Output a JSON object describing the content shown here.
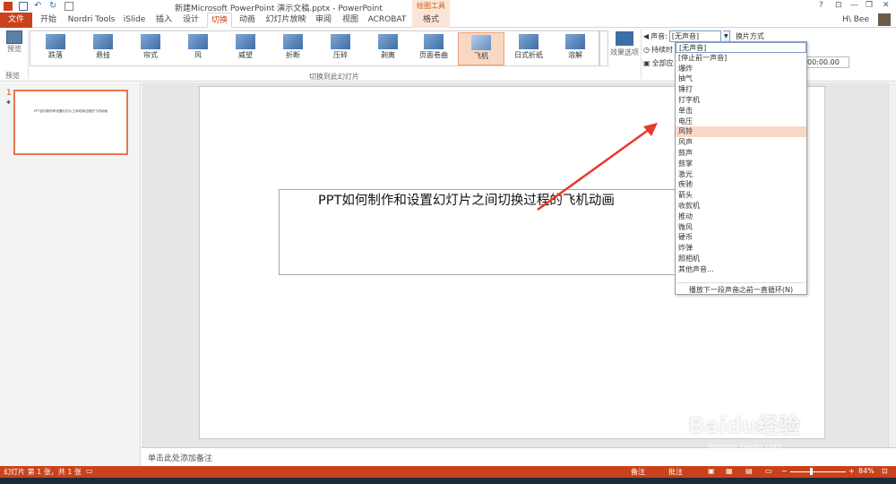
{
  "window": {
    "title": "新建Microsoft PowerPoint 演示文稿.pptx - PowerPoint",
    "context_tab_group": "绘图工具",
    "controls": [
      "?",
      "⊡",
      "—",
      "❐",
      "✕"
    ]
  },
  "tabs": [
    "文件",
    "开始",
    "Nordri Tools",
    "iSlide",
    "插入",
    "设计",
    "切换",
    "动画",
    "幻灯片放映",
    "审阅",
    "视图",
    "ACROBAT",
    "格式"
  ],
  "user": {
    "name": "H\\ Bee"
  },
  "ribbon": {
    "preview_label": "预览",
    "preview_group_label": "预览",
    "transitions_group_label": "切换到此幻灯片",
    "transitions": [
      "跌落",
      "悬挂",
      "帘式",
      "风",
      "威望",
      "折断",
      "压碎",
      "剥离",
      "页面卷曲",
      "飞机",
      "日式折纸",
      "溶解"
    ],
    "selected_transition": "飞机",
    "effect_options_label": "效果选项",
    "sound_label": "声音:",
    "sound_value": "[无声音]",
    "advance_label": "换片方式",
    "duration_label": "持续时",
    "apply_all_label": "全部应",
    "duration_value": "00:00.00"
  },
  "dropdown": {
    "items": [
      "[无声音]",
      "[停止前一声音]",
      "爆炸",
      "抽气",
      "锤打",
      "打字机",
      "单击",
      "电压",
      "风铃",
      "风声",
      "鼓声",
      "鼓掌",
      "激光",
      "疾驰",
      "箭头",
      "收款机",
      "推动",
      "微风",
      "硬币",
      "炸弹",
      "照相机",
      "其他声音..."
    ],
    "highlighted": "风铃",
    "loop_label": "播放下一段声音之前一直循环(N)",
    "grip": "∙∙∙∙"
  },
  "thumbnails": {
    "number": "1",
    "star": "✱",
    "text": "PPT如何制作和设置幻灯片之间切换过程的飞机动画"
  },
  "slide": {
    "title": "PPT如何制作和设置幻灯片之间切换过程的飞机动画"
  },
  "notes": {
    "placeholder": "单击此处添加备注"
  },
  "status": {
    "slide_info": "幻灯片 第 1 张，共 1 张",
    "notes_label": "备注",
    "comments_label": "批注",
    "zoom": "84%"
  },
  "watermark": {
    "line1": "Baidu经验",
    "line2": "jingyan.baidu.com"
  },
  "colors": {
    "accent": "#c9421b",
    "highlight": "#f9d8c8",
    "drawtools": "#fbe5d6"
  }
}
